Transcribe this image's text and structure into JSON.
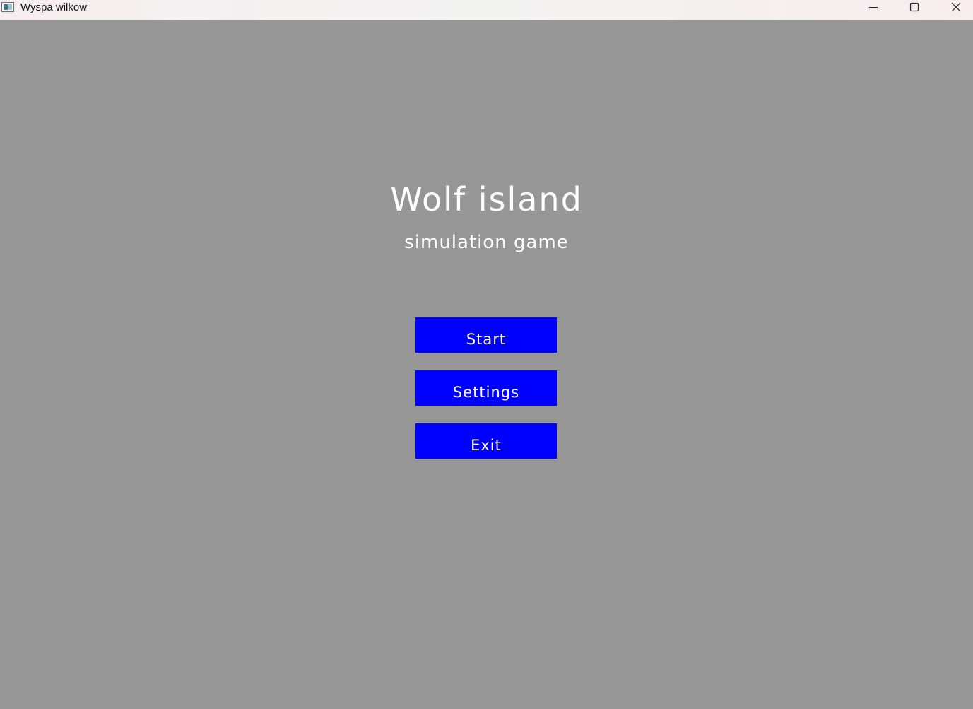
{
  "window": {
    "title": "Wyspa wilkow",
    "controls": {
      "minimize": "minimize-icon",
      "maximize": "maximize-icon",
      "close": "close-icon"
    }
  },
  "menu": {
    "title": "Wolf island",
    "subtitle": "simulation game",
    "buttons": {
      "start": "Start",
      "settings": "Settings",
      "exit": "Exit"
    }
  },
  "colors": {
    "background": "#969696",
    "button": "#0000ff",
    "text": "#ffffff"
  }
}
